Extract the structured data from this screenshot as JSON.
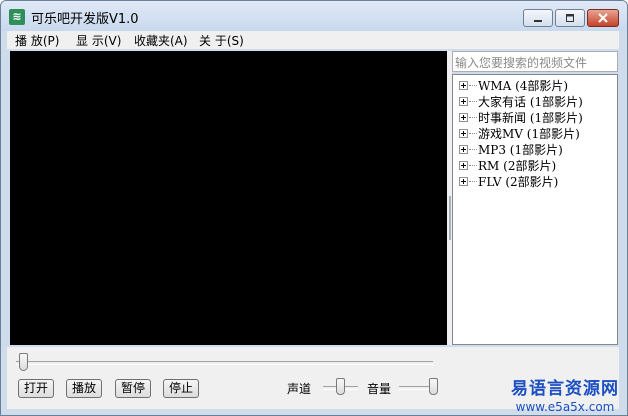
{
  "window": {
    "title": "可乐吧开发版V1.0",
    "icon": "app-logo-icon",
    "controls": [
      "minimize-icon",
      "maximize-icon",
      "close-icon"
    ]
  },
  "menu": [
    "播 放(P)",
    "显 示(V)",
    "收藏夹(A)",
    "关 于(S)"
  ],
  "search": {
    "placeholder": "输入您要搜索的视频文件",
    "value": ""
  },
  "tree": [
    {
      "label": "WMA  (4部影片)"
    },
    {
      "label": "大家有话  (1部影片)"
    },
    {
      "label": "时事新闻  (1部影片)"
    },
    {
      "label": "游戏MV  (1部影片)"
    },
    {
      "label": "MP3  (1部影片)"
    },
    {
      "label": "RM  (2部影片)"
    },
    {
      "label": "FLV  (2部影片)"
    }
  ],
  "controls": {
    "buttons": [
      "打开",
      "播放",
      "暂停",
      "停止"
    ],
    "seek_position": 0,
    "balance_label": "声道",
    "balance_position": 0.5,
    "volume_label": "音量",
    "volume_position": 1.0
  },
  "watermark": {
    "text": "易语言资源网",
    "url": "www.e5a5x.com"
  },
  "colors": {
    "video_background": "#000000",
    "watermark": "#1b4fc2",
    "close_button": "#c4432b"
  }
}
